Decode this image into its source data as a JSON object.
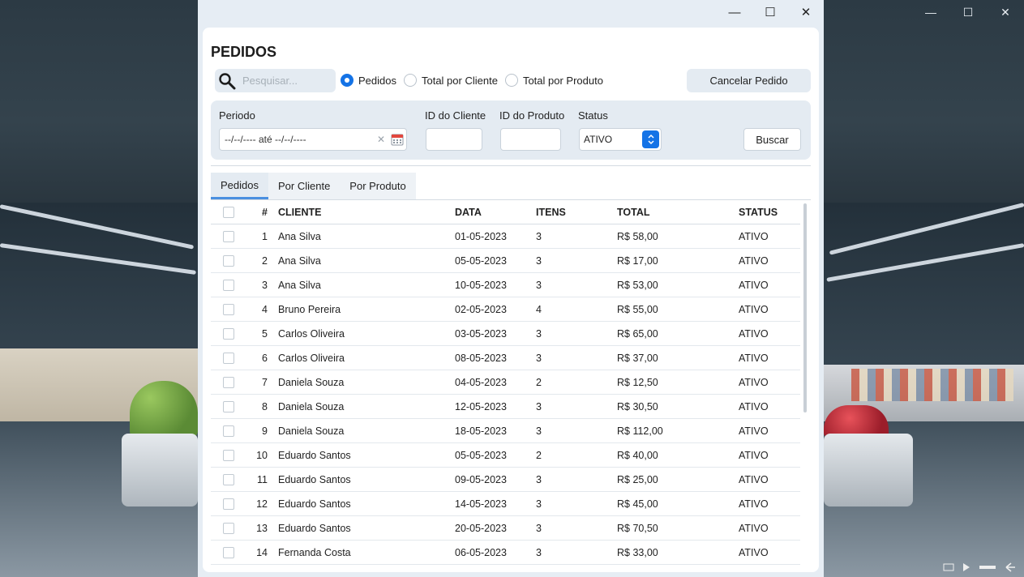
{
  "window_controls": {
    "minimize": "—",
    "maximize": "☐",
    "close": "✕"
  },
  "app": {
    "title": "PEDIDOS",
    "search": {
      "placeholder": "Pesquisar...",
      "value": ""
    },
    "view_options": [
      {
        "label": "Pedidos",
        "selected": true
      },
      {
        "label": "Total por Cliente",
        "selected": false
      },
      {
        "label": "Total por Produto",
        "selected": false
      }
    ],
    "cancel_button": "Cancelar Pedido",
    "filters": {
      "period_label": "Periodo",
      "period_value": "--/--/---- até --/--/----",
      "client_id_label": "ID do Cliente",
      "client_id_value": "",
      "product_id_label": "ID do Produto",
      "product_id_value": "",
      "status_label": "Status",
      "status_value": "ATIVO",
      "search_button": "Buscar"
    },
    "tabs": [
      {
        "label": "Pedidos",
        "active": true
      },
      {
        "label": "Por Cliente",
        "active": false
      },
      {
        "label": "Por Produto",
        "active": false
      }
    ],
    "table": {
      "columns": [
        "#",
        "CLIENTE",
        "DATA",
        "ITENS",
        "TOTAL",
        "STATUS"
      ],
      "rows": [
        [
          "1",
          "Ana Silva",
          "01-05-2023",
          "3",
          "R$ 58,00",
          "ATIVO"
        ],
        [
          "2",
          "Ana Silva",
          "05-05-2023",
          "3",
          "R$ 17,00",
          "ATIVO"
        ],
        [
          "3",
          "Ana Silva",
          "10-05-2023",
          "3",
          "R$ 53,00",
          "ATIVO"
        ],
        [
          "4",
          "Bruno Pereira",
          "02-05-2023",
          "4",
          "R$ 55,00",
          "ATIVO"
        ],
        [
          "5",
          "Carlos Oliveira",
          "03-05-2023",
          "3",
          "R$ 65,00",
          "ATIVO"
        ],
        [
          "6",
          "Carlos Oliveira",
          "08-05-2023",
          "3",
          "R$ 37,00",
          "ATIVO"
        ],
        [
          "7",
          "Daniela Souza",
          "04-05-2023",
          "2",
          "R$ 12,50",
          "ATIVO"
        ],
        [
          "8",
          "Daniela Souza",
          "12-05-2023",
          "3",
          "R$ 30,50",
          "ATIVO"
        ],
        [
          "9",
          "Daniela Souza",
          "18-05-2023",
          "3",
          "R$ 112,00",
          "ATIVO"
        ],
        [
          "10",
          "Eduardo Santos",
          "05-05-2023",
          "2",
          "R$ 40,00",
          "ATIVO"
        ],
        [
          "11",
          "Eduardo Santos",
          "09-05-2023",
          "3",
          "R$ 25,00",
          "ATIVO"
        ],
        [
          "12",
          "Eduardo Santos",
          "14-05-2023",
          "3",
          "R$ 45,00",
          "ATIVO"
        ],
        [
          "13",
          "Eduardo Santos",
          "20-05-2023",
          "3",
          "R$ 70,50",
          "ATIVO"
        ],
        [
          "14",
          "Fernanda Costa",
          "06-05-2023",
          "3",
          "R$ 33,00",
          "ATIVO"
        ]
      ]
    }
  },
  "colors": {
    "accent": "#1473e6",
    "panel": "#e4ebf2",
    "window_bg": "#e6edf4"
  },
  "icons": [
    "search-icon",
    "calendar-icon",
    "clear-icon",
    "spinner-arrows-icon",
    "minimize-icon",
    "maximize-icon",
    "close-icon"
  ]
}
